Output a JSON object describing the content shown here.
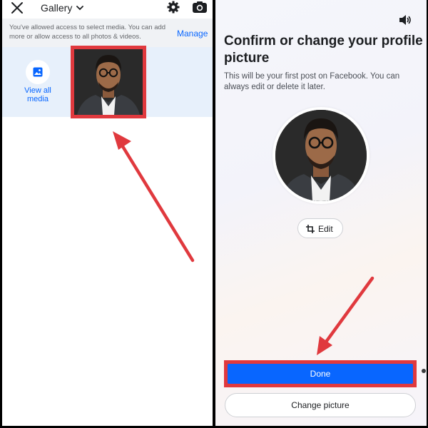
{
  "left_panel": {
    "header": {
      "title": "Gallery",
      "icons": [
        "close-icon",
        "chevron-down-icon",
        "gear-icon",
        "camera-icon"
      ]
    },
    "access_notice": {
      "text": "You've allowed access to select media. You can add more or allow access to all photos & videos.",
      "manage_label": "Manage"
    },
    "view_all": {
      "icon": "image-icon",
      "label": "View all media"
    }
  },
  "right_panel": {
    "title": "Confirm or change your profile picture",
    "subtitle": "This will be your first post on Facebook. You can always edit or delete it later.",
    "edit_label": "Edit",
    "done_label": "Done",
    "change_label": "Change picture",
    "icons": [
      "sound-icon",
      "crop-icon"
    ]
  },
  "colors": {
    "accent_blue": "#0866ff",
    "highlight_red": "#e0393e",
    "divider": "#000000"
  }
}
